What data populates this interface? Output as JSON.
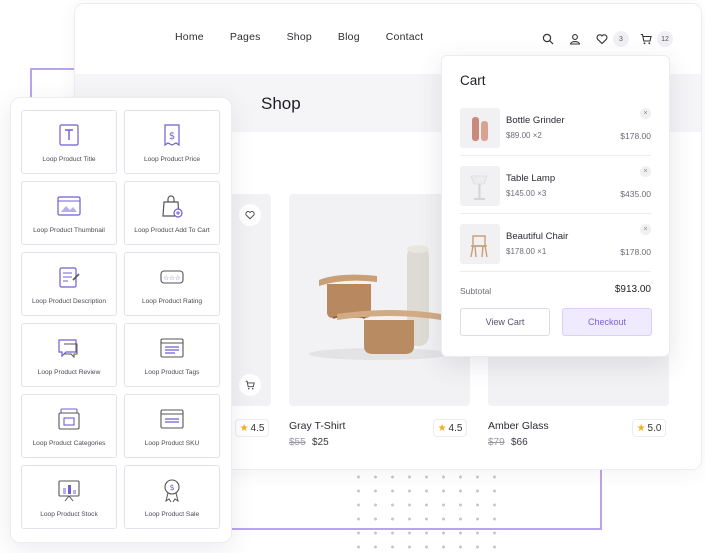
{
  "nav": {
    "links": [
      "Home",
      "Pages",
      "Shop",
      "Blog",
      "Contact"
    ],
    "wishlist_count": "3",
    "cart_count": "12"
  },
  "page": {
    "title": "Shop"
  },
  "products": [
    {
      "rating": "4.5"
    },
    {
      "name": "Gray T-Shirt",
      "old_price": "$55",
      "price": "$25",
      "rating": "4.5"
    },
    {
      "name": "Amber Glass",
      "old_price": "$79",
      "price": "$66",
      "rating": "5.0"
    }
  ],
  "widgets": [
    {
      "label": "Loop Product Title",
      "icon": "title-icon"
    },
    {
      "label": "Loop Product Price",
      "icon": "price-tag-icon"
    },
    {
      "label": "Loop Product Thumbnail",
      "icon": "image-icon"
    },
    {
      "label": "Loop Product Add To Cart",
      "icon": "shopping-bag-icon"
    },
    {
      "label": "Loop Product Description",
      "icon": "description-icon"
    },
    {
      "label": "Loop Product Rating",
      "icon": "rating-stars-icon"
    },
    {
      "label": "Loop Product Review",
      "icon": "review-bubble-icon"
    },
    {
      "label": "Loop Product Tags",
      "icon": "tags-icon"
    },
    {
      "label": "Loop Product Categories",
      "icon": "categories-icon"
    },
    {
      "label": "Loop Product SKU",
      "icon": "sku-icon"
    },
    {
      "label": "Loop Product Stock",
      "icon": "stock-chart-icon"
    },
    {
      "label": "Loop Product Sale",
      "icon": "sale-badge-icon"
    }
  ],
  "cart": {
    "title": "Cart",
    "items": [
      {
        "name": "Bottle Grinder",
        "qty": "$89.00 ×2",
        "price": "$178.00"
      },
      {
        "name": "Table Lamp",
        "qty": "$145.00 ×3",
        "price": "$435.00"
      },
      {
        "name": "Beautiful Chair",
        "qty": "$178.00 ×1",
        "price": "$178.00"
      }
    ],
    "subtotal_label": "Subtotal",
    "subtotal_value": "$913.00",
    "view_cart": "View Cart",
    "checkout": "Checkout"
  },
  "colors": {
    "accent": "#7a63d6",
    "accent_bg": "#efeafd",
    "frame_line": "#b9a4f0",
    "star": "#f2b01e"
  }
}
